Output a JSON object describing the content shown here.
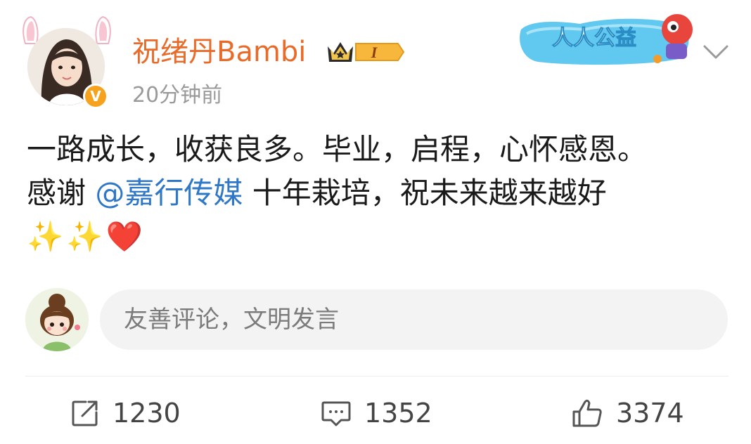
{
  "post": {
    "author": "祝绪丹Bambi",
    "time": "20分钟前",
    "verified_symbol": "V",
    "vip_level": "I",
    "badge_text": "人人公益",
    "text_line1": "一路成长，收获良多。毕业，启程，心怀感恩。",
    "text_line2_before": "感谢 ",
    "mention": "@嘉行传媒",
    "text_line2_after": " 十年栽培，祝未来越来越好",
    "emojis": [
      "✨",
      "✨",
      "❤️"
    ]
  },
  "comment": {
    "placeholder": "友善评论，文明发言"
  },
  "actions": {
    "repost_count": "1230",
    "comment_count": "1352",
    "like_count": "3374"
  },
  "colors": {
    "username": "#e86b2a",
    "mention": "#2f77c7",
    "verified": "#f7a21c",
    "secondary_text": "#9a9a9a"
  },
  "icons": [
    "bunny-ear-icon",
    "verified-icon",
    "crown-icon",
    "chevron-down-icon",
    "share-icon",
    "comment-icon",
    "thumbs-up-icon"
  ]
}
